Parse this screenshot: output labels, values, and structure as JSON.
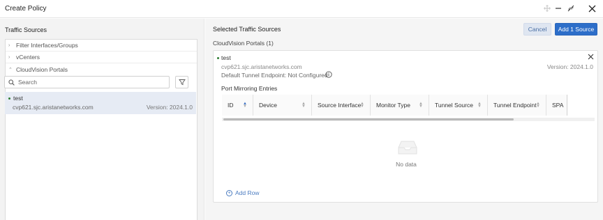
{
  "window": {
    "title": "Create Policy"
  },
  "left": {
    "heading": "Traffic Sources",
    "tree": [
      {
        "label": "Filter Interfaces/Groups",
        "expanded": false
      },
      {
        "label": "vCenters",
        "expanded": false
      },
      {
        "label": "CloudVision Portals",
        "expanded": true
      }
    ],
    "search": {
      "placeholder": "Search",
      "value": ""
    },
    "selected": {
      "name": "test",
      "host": "cvp621.sjc.aristanetworks.com",
      "version": "Version: 2024.1.0"
    }
  },
  "right": {
    "heading": "Selected Traffic Sources",
    "cancel_label": "Cancel",
    "add_label": "Add 1 Source",
    "group_label": "CloudVision Portals (1)",
    "card": {
      "name": "test",
      "host": "cvp621.sjc.aristanetworks.com",
      "version": "Version: 2024.1.0",
      "tunnel": "Default Tunnel Endpoint: Not Configured",
      "section": "Port Mirroring Entries",
      "columns": [
        "ID",
        "Device",
        "Source Interface",
        "Monitor Type",
        "Tunnel Source",
        "Tunnel Endpoint",
        "SPA"
      ],
      "empty_text": "No data",
      "add_row_label": "Add Row"
    }
  },
  "colors": {
    "accent": "#2d6ec9",
    "selected_bg": "#e6ebf4",
    "status_dot": "#2e7d32"
  }
}
